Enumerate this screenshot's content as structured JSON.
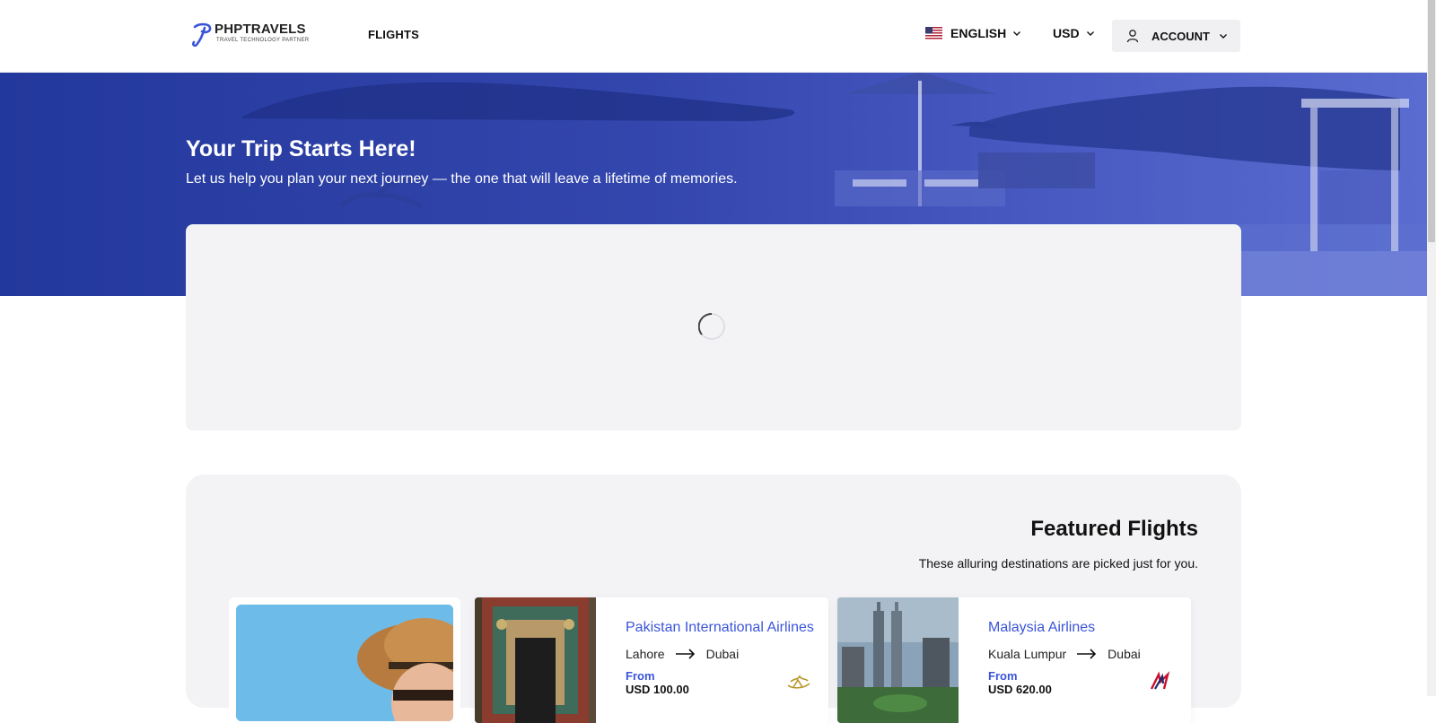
{
  "header": {
    "logo": {
      "name": "PHPTRAVELS",
      "tagline": "TRAVEL TECHNOLOGY PARTNER"
    },
    "nav": {
      "flights": "FLIGHTS"
    },
    "language": {
      "label": "ENGLISH",
      "flag": "us-flag-icon"
    },
    "currency": {
      "label": "USD"
    },
    "account": {
      "label": "ACCOUNT"
    }
  },
  "hero": {
    "title": "Your Trip Starts Here!",
    "subtitle": "Let us help you plan your next journey — the one that will leave a lifetime of memories."
  },
  "featured": {
    "title": "Featured Flights",
    "subtitle": "These alluring destinations are picked just for you.",
    "cards": [
      {
        "airline": "Pakistan International Airlines",
        "from_city": "Lahore",
        "to_city": "Dubai",
        "from_label": "From",
        "price": "USD 100.00"
      },
      {
        "airline": "Malaysia Airlines",
        "from_city": "Kuala Lumpur",
        "to_city": "Dubai",
        "from_label": "From",
        "price": "USD 620.00"
      }
    ]
  },
  "colors": {
    "accent": "#3b55d9",
    "hero_blue": "#2b3fa8",
    "panel_bg": "#f3f3f6"
  }
}
